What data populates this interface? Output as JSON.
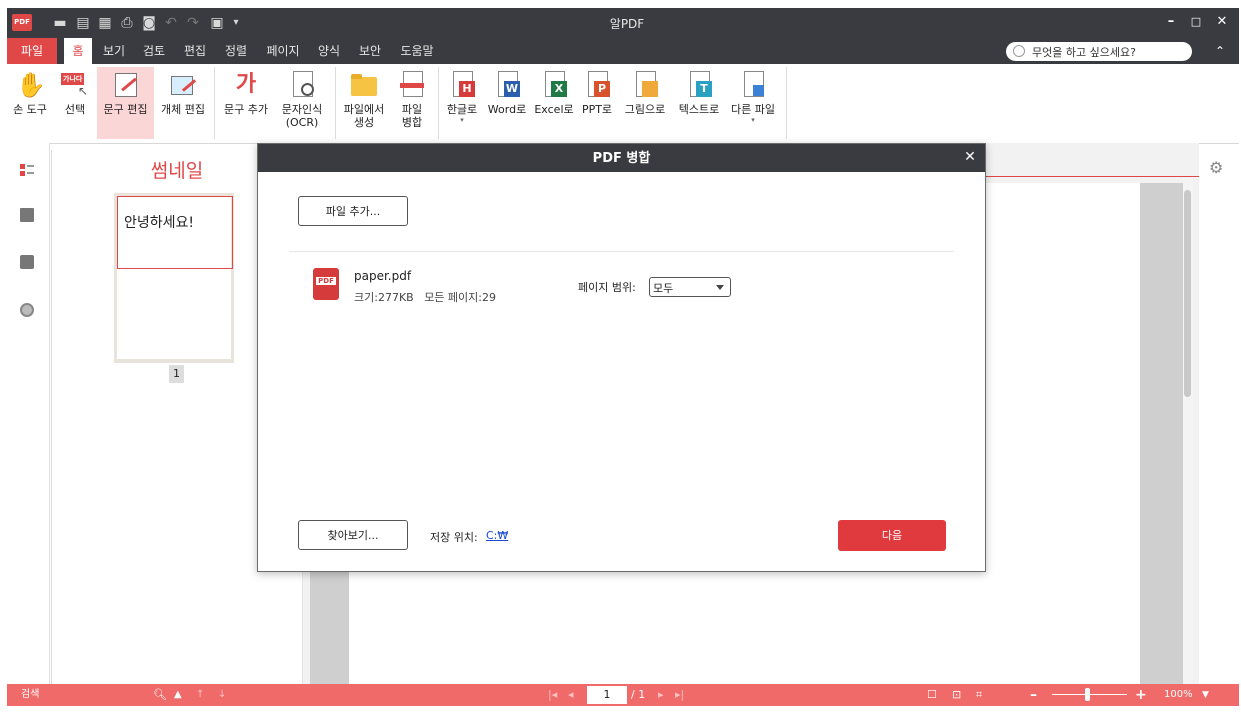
{
  "app": {
    "logo": "PDF",
    "title": "알PDF"
  },
  "menu": {
    "items": [
      "파일",
      "홈",
      "보기",
      "검토",
      "편집",
      "정렬",
      "페이지",
      "양식",
      "보안",
      "도움말"
    ],
    "search_placeholder": "무엇을 하고 싶으세요?"
  },
  "ribbon": {
    "hand": "손 도구",
    "select": "선택",
    "select_badge": "가나다",
    "edit_text": "문구 편집",
    "edit_object": "개체 편집",
    "add_text": "문구 추가",
    "add_text_glyph": "가",
    "ocr": "문자인식\n(OCR)",
    "create_from_file": "파일에서\n생성",
    "merge": "파일\n병합",
    "to_hwp": "한글로",
    "to_word": "Word로",
    "to_excel": "Excel로",
    "to_ppt": "PPT로",
    "to_image": "그림으로",
    "to_text": "텍스트로",
    "to_other": "다른 파일",
    "badge_h": "H",
    "badge_w": "W",
    "badge_x": "X",
    "badge_p": "P",
    "badge_t": "T"
  },
  "thumbnail": {
    "title": "썸네일",
    "page_text": "안녕하세요!",
    "page_number": "1"
  },
  "status": {
    "search": "검색",
    "current_page": "1",
    "total_pages": "/ 1",
    "zoom": "100%"
  },
  "dialog": {
    "title": "PDF 병합",
    "add_file": "파일 추가...",
    "file_name": "paper.pdf",
    "file_meta": "크기:277KB   모든 페이지:29",
    "range_label": "페이지 범위:",
    "range_value": "모두",
    "browse": "찾아보기...",
    "save_label": "저장 위치:",
    "save_path": "C:₩",
    "next": "다음"
  },
  "colors": {
    "accent": "#e04848",
    "titlebar": "#3a3b40",
    "statusbar": "#f06a6a"
  }
}
